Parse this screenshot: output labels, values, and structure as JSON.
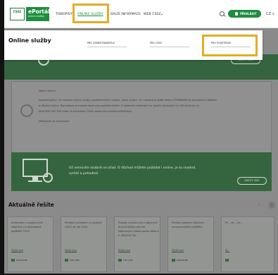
{
  "header": {
    "logo_mark_text": "Česká správa sociálního zabezpečení",
    "portal_name": "ePortál",
    "portal_subtitle": "online služby",
    "nav": [
      "TISKOPISY",
      "ONLINE SLUŽBY",
      "DALŠÍ INFORMACE",
      "WEB ČSSZ"
    ],
    "login_label": "PŘIHLÁSIT",
    "lang_label": "CZ ∨",
    "highlight_color": "#e3ad25",
    "brand_color": "#1e8d3e"
  },
  "modal": {
    "title": "Online služby",
    "options": [
      "PRO ZAMĚSTNAVATELE",
      "PRO OSVČ",
      "PRO POJIŠTĚNCE"
    ]
  },
  "background": {
    "banner1_button": "ZJISTIT VÍCE",
    "info_heading": "Vážení klienti,",
    "info_text_1": "upozorňujeme, že možnost online služby prostřednictvím služby „Moje služby“ je v současné době velkou VÝHRADNĚ ke konzultaci k žádosti",
    "info_text_2": "o důchod online. Konzultace je možné domluvit prostřednictvím. V ostatních případech se prosím obracejte na call centrum na",
    "info_text_3": "čísle 800 055 245 nebo na příslušnou OSSZ www.cssz.cz/web/cz/kontakty.",
    "info_thanks": "Děkujeme za pochopení.",
    "banner2_text": "Už nemusíte osobně na úřad. O důchod můžete požádat i online, je to snadné, rychlé a pohodlné.",
    "banner2_button": "ZJISTIT VÍCE",
    "section_title": "Aktuálně řešíte",
    "arrow_left": "‹",
    "arrow_right": "›",
    "cards": [
      {
        "title": "Informace o zaplacených zálohách na důchodové pojištění OSVČ",
        "link": "Zjistit více",
        "badge": "SPOLEČNÉ"
      },
      {
        "title": "Přehled o příjmech a výdajích OSVČ za rok 2024",
        "link": "Zjistit více",
        "badge": "TIPY DNE"
      },
      {
        "title": "Žádost o prominutí a stanovení dlužné částky penále zálohových plateb podle zákona č. 66/2022 Sb.",
        "link": "Zjistit více",
        "badge": "TIPY DNE"
      },
      {
        "title": "Přehled plateb k důchodu nemocenského pojištění",
        "link": "Zjistit více",
        "badge": "SPOLEČNÉ"
      },
      {
        "title": "Př... zá... ne...",
        "link": "Zj...",
        "badge": ""
      }
    ]
  }
}
